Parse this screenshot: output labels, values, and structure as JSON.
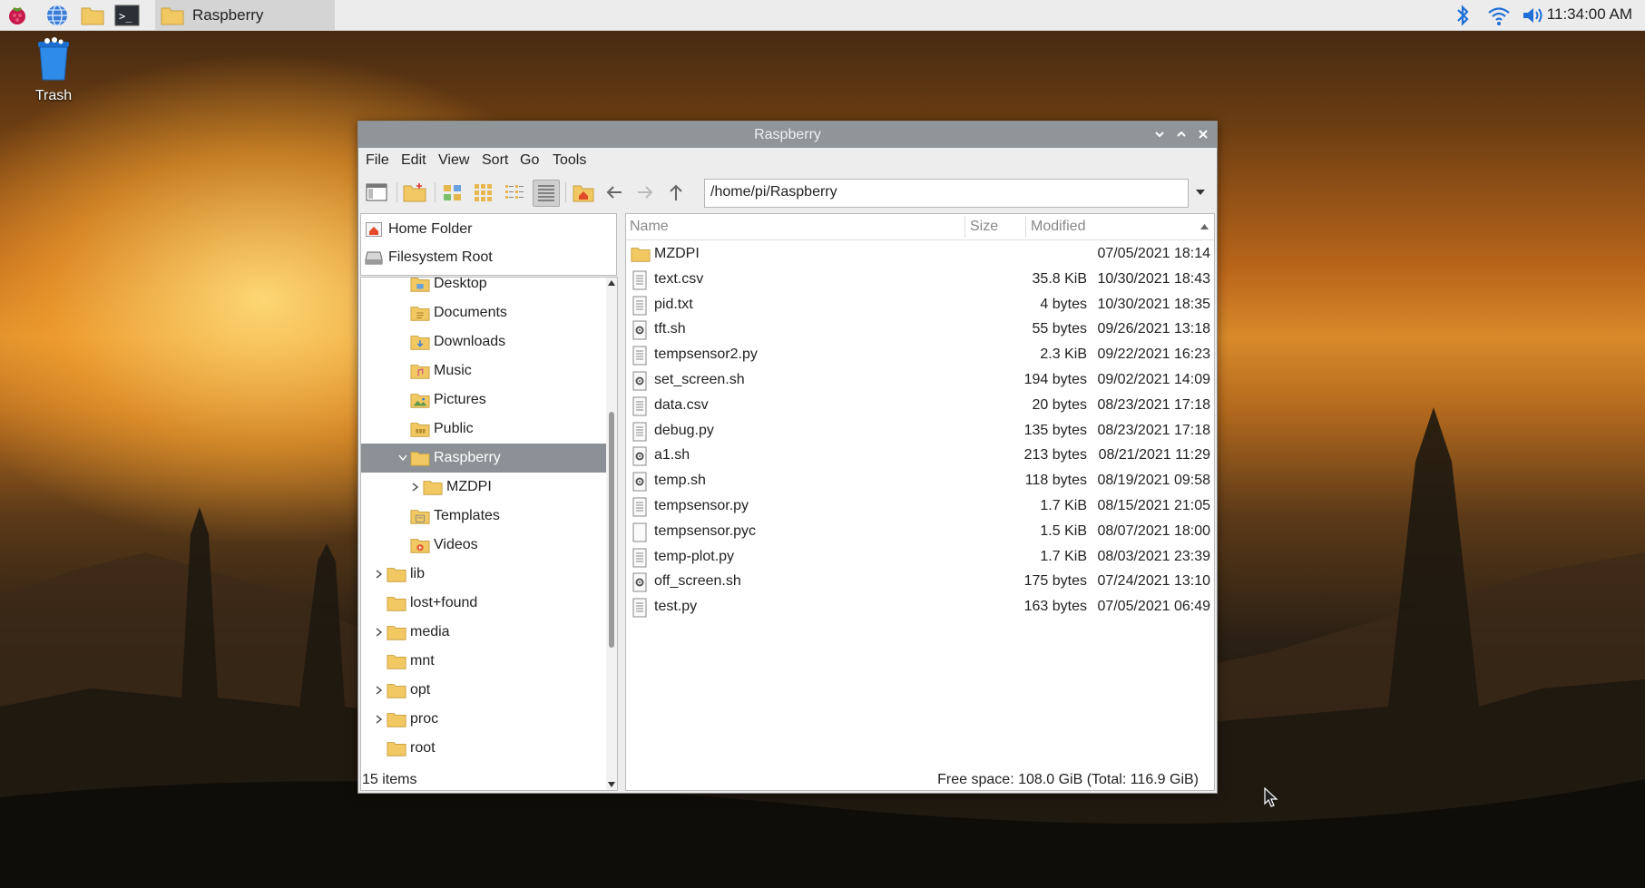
{
  "taskbar": {
    "launchers": [
      "raspberry-menu-icon",
      "web-browser-icon",
      "file-manager-icon",
      "terminal-icon"
    ],
    "task_label": "Raspberry",
    "tray": [
      "bluetooth-icon",
      "wifi-icon",
      "volume-icon"
    ],
    "clock": "11:34:00 AM"
  },
  "desktop": {
    "trash_label": "Trash"
  },
  "window": {
    "title": "Raspberry",
    "menu": [
      "File",
      "Edit",
      "View",
      "Sort",
      "Go",
      "Tools"
    ],
    "path": "/home/pi/Raspberry",
    "places": [
      {
        "label": "Home Folder",
        "icon": "home-icon"
      },
      {
        "label": "Filesystem Root",
        "icon": "drive-icon"
      }
    ],
    "tree": [
      {
        "label": "Desktop",
        "icon": "desktop-folder-icon",
        "level": 2,
        "expander": ""
      },
      {
        "label": "Documents",
        "icon": "documents-folder-icon",
        "level": 2,
        "expander": ""
      },
      {
        "label": "Downloads",
        "icon": "downloads-folder-icon",
        "level": 2,
        "expander": ""
      },
      {
        "label": "Music",
        "icon": "music-folder-icon",
        "level": 2,
        "expander": ""
      },
      {
        "label": "Pictures",
        "icon": "pictures-folder-icon",
        "level": 2,
        "expander": ""
      },
      {
        "label": "Public",
        "icon": "public-folder-icon",
        "level": 2,
        "expander": ""
      },
      {
        "label": "Raspberry",
        "icon": "folder-icon",
        "level": 2,
        "expander": "open",
        "selected": true
      },
      {
        "label": "MZDPI",
        "icon": "folder-icon",
        "level": 3,
        "expander": "closed"
      },
      {
        "label": "Templates",
        "icon": "templates-folder-icon",
        "level": 2,
        "expander": ""
      },
      {
        "label": "Videos",
        "icon": "videos-folder-icon",
        "level": 2,
        "expander": ""
      },
      {
        "label": "lib",
        "icon": "folder-icon",
        "level": 1,
        "expander": "closed"
      },
      {
        "label": "lost+found",
        "icon": "folder-icon",
        "level": 1,
        "expander": ""
      },
      {
        "label": "media",
        "icon": "folder-icon",
        "level": 1,
        "expander": "closed"
      },
      {
        "label": "mnt",
        "icon": "folder-icon",
        "level": 1,
        "expander": ""
      },
      {
        "label": "opt",
        "icon": "folder-icon",
        "level": 1,
        "expander": "closed"
      },
      {
        "label": "proc",
        "icon": "folder-icon",
        "level": 1,
        "expander": "closed"
      },
      {
        "label": "root",
        "icon": "folder-icon",
        "level": 1,
        "expander": ""
      }
    ],
    "columns": {
      "name": "Name",
      "size": "Size",
      "modified": "Modified"
    },
    "files": [
      {
        "name": "MZDPI",
        "size": "",
        "modified": "07/05/2021 18:14",
        "icon": "folder-icon"
      },
      {
        "name": "text.csv",
        "size": "35.8 KiB",
        "modified": "10/30/2021 18:43",
        "icon": "text-file-icon"
      },
      {
        "name": "pid.txt",
        "size": "4 bytes",
        "modified": "10/30/2021 18:35",
        "icon": "text-file-icon"
      },
      {
        "name": "tft.sh",
        "size": "55 bytes",
        "modified": "09/26/2021 13:18",
        "icon": "script-file-icon"
      },
      {
        "name": "tempsensor2.py",
        "size": "2.3 KiB",
        "modified": "09/22/2021 16:23",
        "icon": "text-file-icon"
      },
      {
        "name": "set_screen.sh",
        "size": "194 bytes",
        "modified": "09/02/2021 14:09",
        "icon": "script-file-icon"
      },
      {
        "name": "data.csv",
        "size": "20 bytes",
        "modified": "08/23/2021 17:18",
        "icon": "text-file-icon"
      },
      {
        "name": "debug.py",
        "size": "135 bytes",
        "modified": "08/23/2021 17:18",
        "icon": "text-file-icon"
      },
      {
        "name": "a1.sh",
        "size": "213 bytes",
        "modified": "08/21/2021 11:29",
        "icon": "script-file-icon"
      },
      {
        "name": "temp.sh",
        "size": "118 bytes",
        "modified": "08/19/2021 09:58",
        "icon": "script-file-icon"
      },
      {
        "name": "tempsensor.py",
        "size": "1.7 KiB",
        "modified": "08/15/2021 21:05",
        "icon": "text-file-icon"
      },
      {
        "name": "tempsensor.pyc",
        "size": "1.5 KiB",
        "modified": "08/07/2021 18:00",
        "icon": "blank-file-icon"
      },
      {
        "name": "temp-plot.py",
        "size": "1.7 KiB",
        "modified": "08/03/2021 23:39",
        "icon": "text-file-icon"
      },
      {
        "name": "off_screen.sh",
        "size": "175 bytes",
        "modified": "07/24/2021 13:10",
        "icon": "script-file-icon"
      },
      {
        "name": "test.py",
        "size": "163 bytes",
        "modified": "07/05/2021 06:49",
        "icon": "text-file-icon"
      }
    ],
    "status_left": "15 items",
    "status_right": "Free space: 108.0 GiB (Total: 116.9 GiB)"
  },
  "colors": {
    "folder": "#f2c862",
    "selection": "#8b9196",
    "titlebar": "#8f9599"
  }
}
